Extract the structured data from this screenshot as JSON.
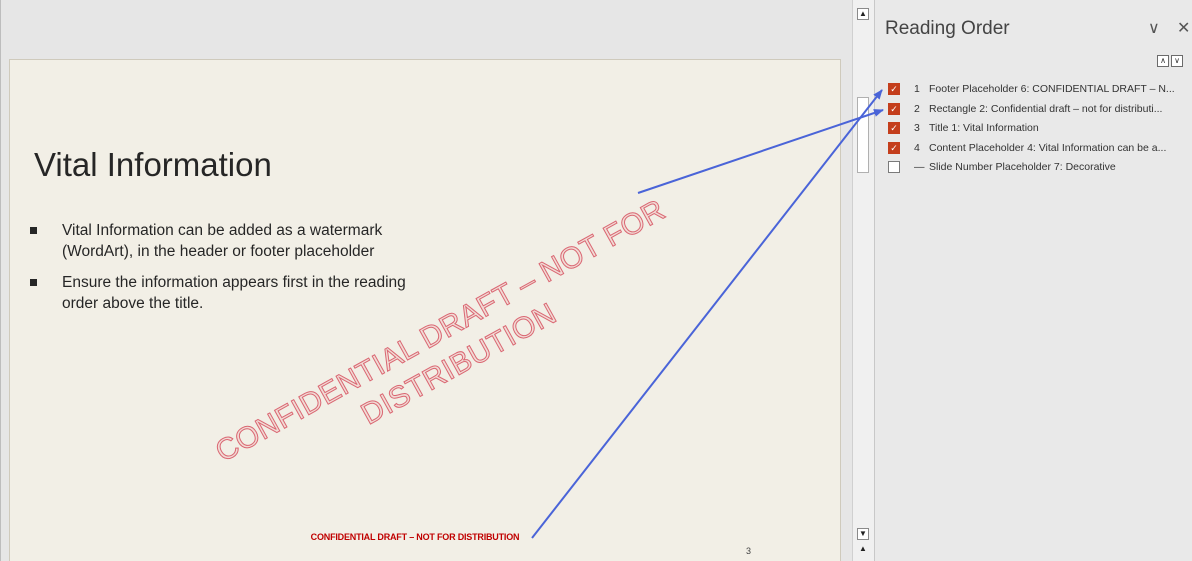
{
  "slide": {
    "title": "Vital Information",
    "bullets": [
      "Vital Information can be added as a watermark (WordArt), in the header or footer placeholder",
      "Ensure the information appears first in the reading order above the title."
    ],
    "watermark_line1": "CONFIDENTIAL DRAFT – NOT FOR",
    "watermark_line2": "DISTRIBUTION",
    "footer": "CONFIDENTIAL DRAFT – NOT FOR DISTRIBUTION",
    "slide_number": "3"
  },
  "pane": {
    "title": "Reading Order",
    "collapse_icon": "∨",
    "close_icon": "✕",
    "move_up_icon": "∧",
    "move_down_icon": "∨",
    "items": [
      {
        "num": "1",
        "label": "Footer Placeholder 6: CONFIDENTIAL DRAFT – N...",
        "checked": true
      },
      {
        "num": "2",
        "label": "Rectangle 2: Confidential draft – not for distributi...",
        "checked": true
      },
      {
        "num": "3",
        "label": "Title 1: Vital Information",
        "checked": true
      },
      {
        "num": "4",
        "label": "Content Placeholder 4: Vital Information can be a...",
        "checked": true
      },
      {
        "num": "—",
        "label": "Slide Number Placeholder 7: Decorative",
        "checked": false
      }
    ]
  },
  "colors": {
    "accent": "#c43e1c",
    "footer_text": "#c00000",
    "arrow": "#4a64d8"
  }
}
